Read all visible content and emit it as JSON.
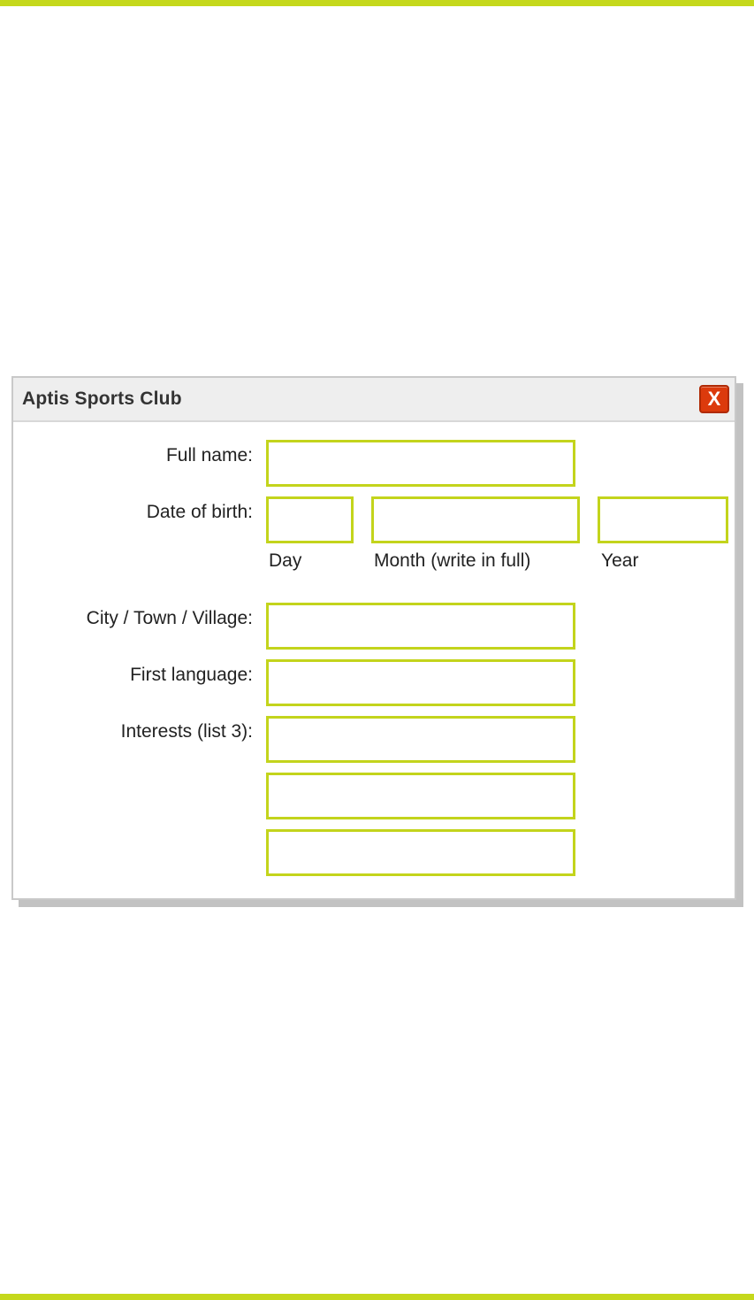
{
  "window": {
    "title": "Aptis Sports Club",
    "close_label": "X"
  },
  "form": {
    "full_name": {
      "label": "Full name:",
      "value": ""
    },
    "date_of_birth": {
      "label": "Date of birth:",
      "day": {
        "caption": "Day",
        "value": ""
      },
      "month": {
        "caption": "Month (write in full)",
        "value": ""
      },
      "year": {
        "caption": "Year",
        "value": ""
      }
    },
    "city": {
      "label": "City / Town / Village:",
      "value": ""
    },
    "first_language": {
      "label": "First language:",
      "value": ""
    },
    "interests": {
      "label": "Interests (list 3):",
      "values": [
        "",
        "",
        ""
      ]
    }
  },
  "colors": {
    "accent": "#c5d81c",
    "field_border": "#c3d41c",
    "close_button": "#dc3a0c",
    "titlebar": "#eeeeee"
  }
}
